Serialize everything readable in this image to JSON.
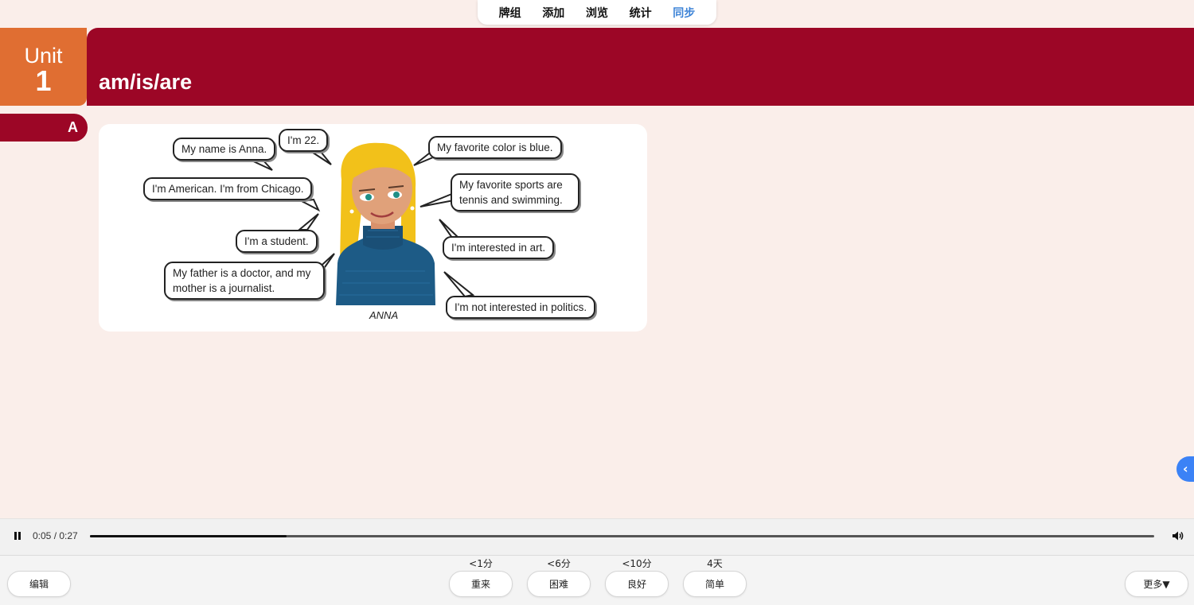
{
  "topnav": {
    "tabs": [
      {
        "label": "牌组",
        "active": false
      },
      {
        "label": "添加",
        "active": false
      },
      {
        "label": "浏览",
        "active": false
      },
      {
        "label": "统计",
        "active": false
      },
      {
        "label": "同步",
        "active": true
      }
    ],
    "active_color": "#3b82d6"
  },
  "header": {
    "unit_word": "Unit",
    "unit_number": "1",
    "title": "am/is/are",
    "section": "A"
  },
  "illustration": {
    "caption": "ANNA",
    "left_bubbles": [
      "My name is Anna.",
      "I'm 22.",
      "I'm American. I'm from Chicago.",
      "I'm a student.",
      "My father is a doctor, and my mother is a journalist."
    ],
    "right_bubbles": [
      "My favorite color is blue.",
      "My favorite sports are tennis and swimming.",
      "I'm interested in art.",
      "I'm not interested in politics."
    ]
  },
  "player": {
    "time": "0:05 / 0:27",
    "progress": 0.185
  },
  "bottom": {
    "edit_label": "编辑",
    "more_label": "更多▼",
    "answers": [
      {
        "interval": "<1分",
        "label": "重来"
      },
      {
        "interval": "<6分",
        "label": "困难"
      },
      {
        "interval": "<10分",
        "label": "良好"
      },
      {
        "interval": "4天",
        "label": "简单"
      }
    ]
  },
  "colors": {
    "maroon": "#9c0626",
    "orange": "#e06e32",
    "background": "#faeeea",
    "accent_blue": "#3b82f6"
  }
}
